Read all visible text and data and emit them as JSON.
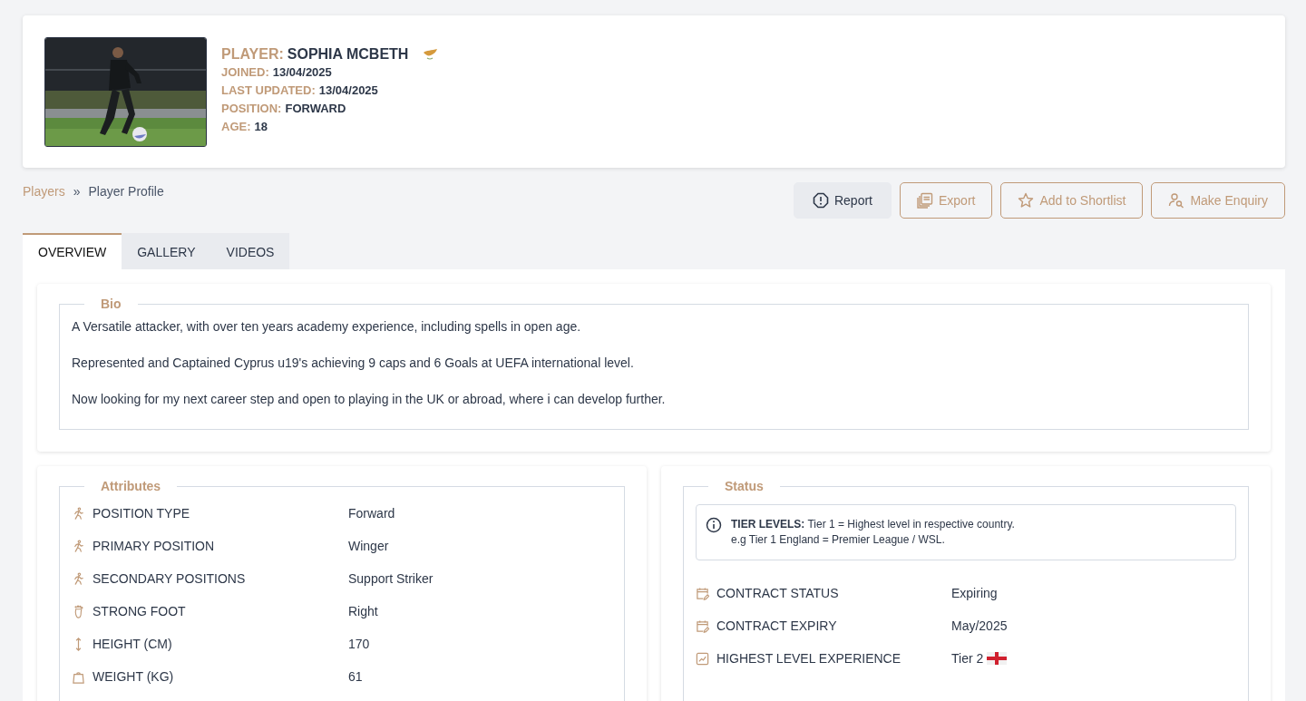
{
  "player": {
    "header": [
      {
        "label": "PLAYER:",
        "value": "SOPHIA MCBETH",
        "flag": true
      },
      {
        "label": "JOINED:",
        "value": "13/04/2025"
      },
      {
        "label": "LAST UPDATED:",
        "value": "13/04/2025"
      },
      {
        "label": "POSITION:",
        "value": "FORWARD"
      },
      {
        "label": "AGE:",
        "value": "18"
      }
    ]
  },
  "breadcrumb": [
    {
      "label": "Players",
      "kind": "link"
    },
    {
      "label": "»",
      "kind": "separator"
    },
    {
      "label": "Player Profile",
      "kind": "current"
    }
  ],
  "actions": [
    {
      "label": "Report",
      "kind": "report"
    },
    {
      "label": "Export",
      "kind": "export"
    },
    {
      "label": "Add to Shortlist",
      "kind": "shortlist"
    },
    {
      "label": "Make Enquiry",
      "kind": "enquiry"
    }
  ],
  "tabs": [
    {
      "label": "OVERVIEW",
      "selected": true
    },
    {
      "label": "GALLERY",
      "selected": false
    },
    {
      "label": "VIDEOS",
      "selected": false
    }
  ],
  "bio": {
    "title": "Bio",
    "paragraphs": [
      "A Versatile attacker, with over ten years academy experience, including spells in open age.",
      "Represented and Captained Cyprus u19's achieving 9 caps and 6 Goals at UEFA international level.",
      "Now looking for my next career step and open to playing in the UK or abroad, where i can develop further."
    ]
  },
  "attributes": {
    "title": "Attributes",
    "rows": [
      {
        "kind": "runner",
        "label": "POSITION TYPE",
        "value": "Forward"
      },
      {
        "kind": "runner",
        "label": "PRIMARY POSITION",
        "value": "Winger"
      },
      {
        "kind": "runner",
        "label": "SECONDARY POSITIONS",
        "value": "Support Striker"
      },
      {
        "kind": "foot",
        "label": "STRONG FOOT",
        "value": "Right"
      },
      {
        "kind": "height",
        "label": "HEIGHT (CM)",
        "value": "170"
      },
      {
        "kind": "weight",
        "label": "WEIGHT (KG)",
        "value": "61"
      }
    ]
  },
  "status": {
    "title": "Status",
    "info": [
      "**TIER LEVELS:** Tier 1 = Highest level in respective country.",
      "e.g Tier 1 England = Premier League / WSL."
    ],
    "rows": [
      {
        "kind": "calendar",
        "label": "CONTRACT STATUS",
        "value": "Expiring"
      },
      {
        "kind": "calendar",
        "label": "CONTRACT EXPIRY",
        "value": "May/2025"
      },
      {
        "kind": "chart",
        "label": "HIGHEST LEVEL EXPERIENCE",
        "value": "Tier 2",
        "flag": true
      }
    ]
  }
}
